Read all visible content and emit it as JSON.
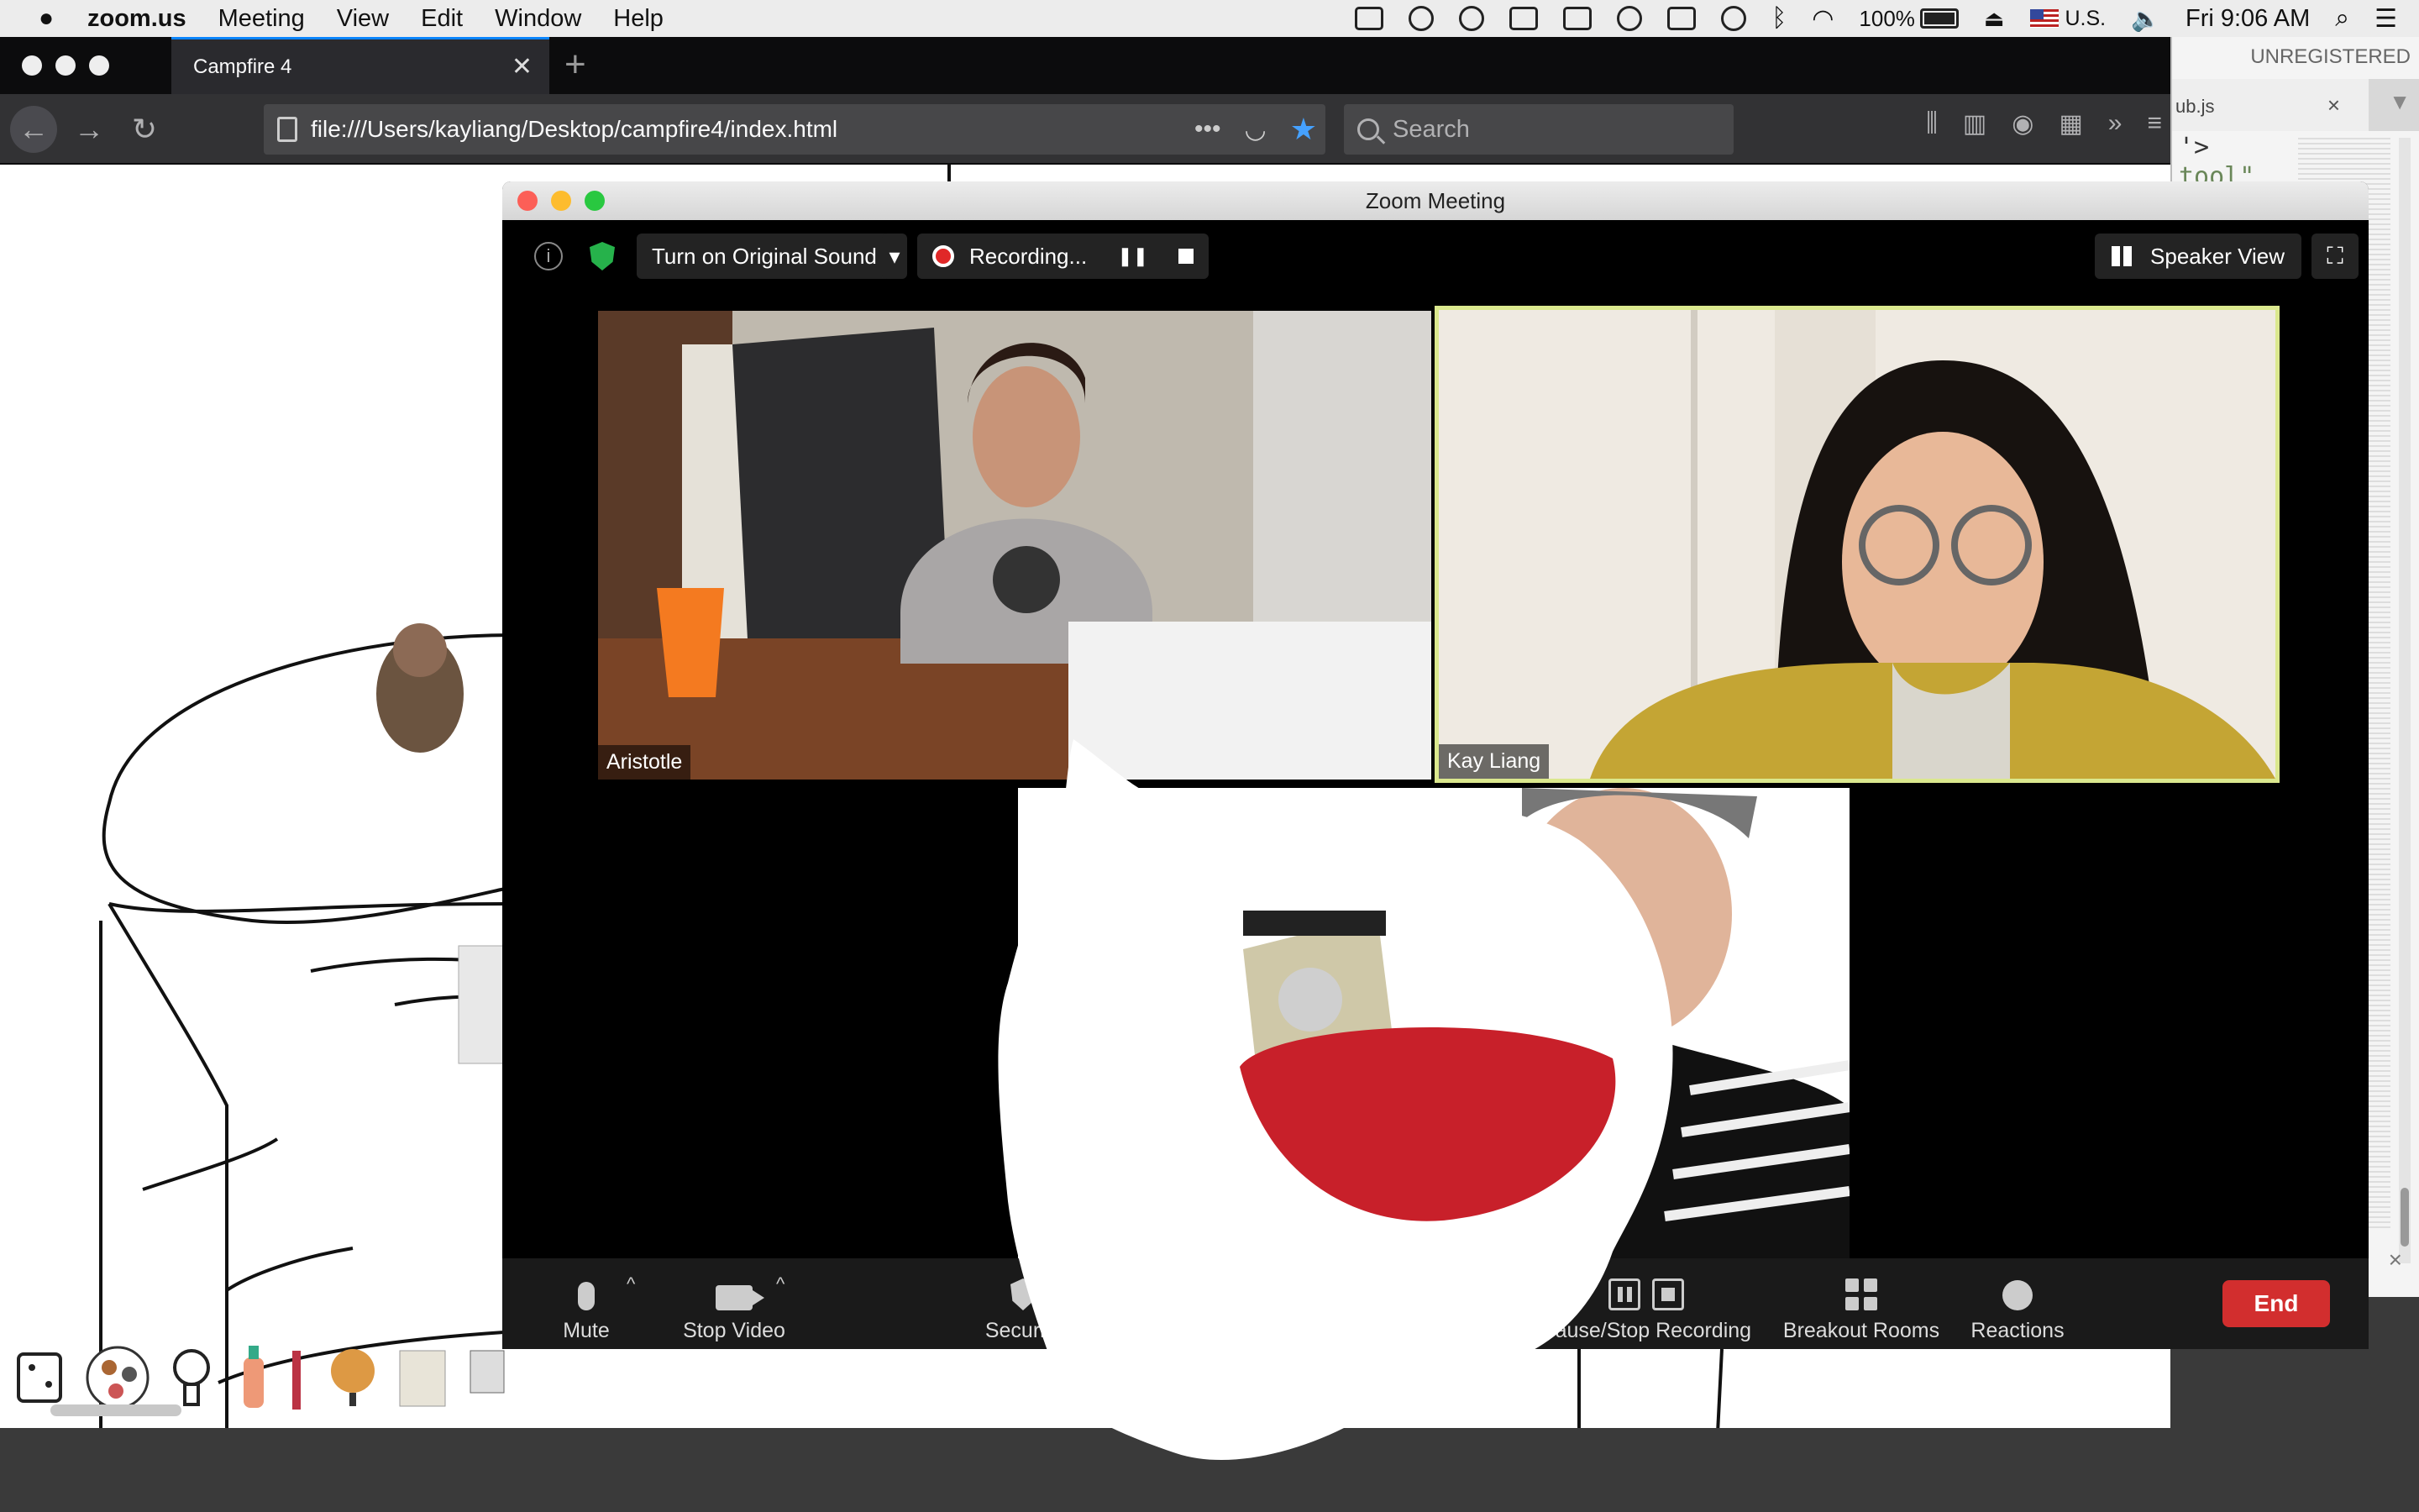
{
  "menubar": {
    "app_name": "zoom.us",
    "items": [
      "Meeting",
      "View",
      "Edit",
      "Window",
      "Help"
    ],
    "battery": "100%",
    "input_source": "U.S.",
    "clock": "Fri 9:06 AM"
  },
  "browser": {
    "tab_title": "Campfire 4",
    "url": "file:///Users/kayliang/Desktop/campfire4/index.html",
    "search_placeholder": "Search",
    "url_more": "•••"
  },
  "editor": {
    "unregistered": "UNREGISTERED",
    "tab_name": "ub.js",
    "code_line_1": "'>",
    "code_line_2": "tool\""
  },
  "zoom": {
    "window_title": "Zoom Meeting",
    "original_sound_label": "Turn on Original Sound",
    "recording_label": "Recording...",
    "speaker_view_label": "Speaker View",
    "participants": [
      "Aristotle",
      "Kay Liang"
    ],
    "toolbar": {
      "mute": "Mute",
      "stop_video": "Stop Video",
      "security": "Security",
      "pause_stop_recording": "Pause/Stop Recording",
      "breakout_rooms": "Breakout Rooms",
      "reactions": "Reactions",
      "end": "End"
    }
  }
}
